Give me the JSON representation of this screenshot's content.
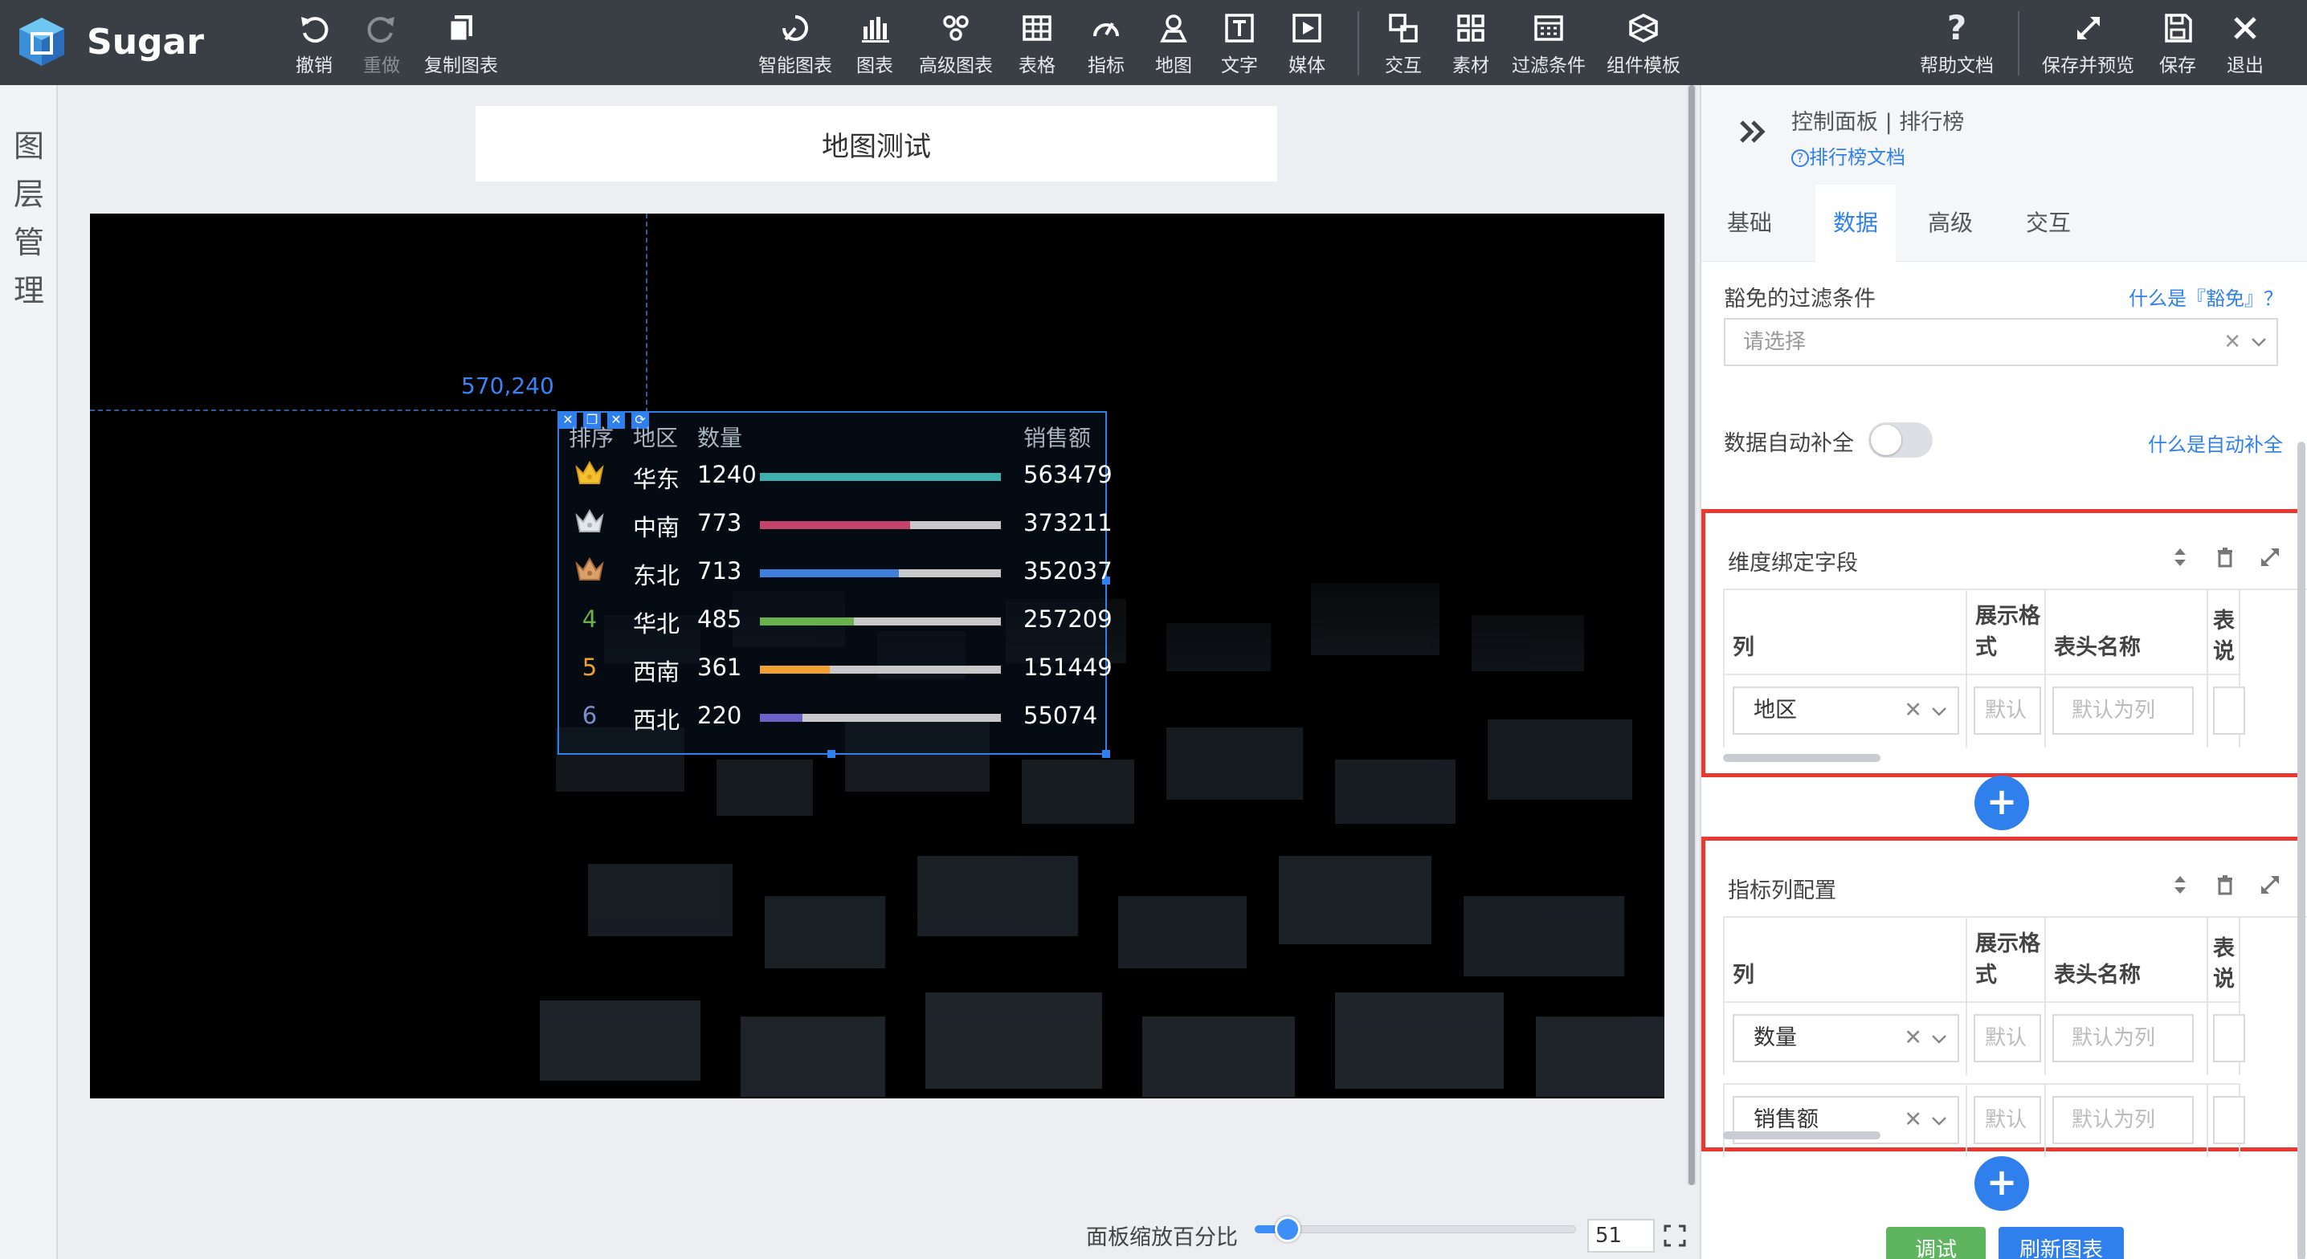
{
  "app": {
    "name": "Sugar"
  },
  "toolbar": {
    "left": [
      {
        "label": "撤销",
        "icon": "undo-icon"
      },
      {
        "label": "重做",
        "icon": "redo-icon",
        "disabled": true
      },
      {
        "label": "复制图表",
        "icon": "copy-icon"
      }
    ],
    "center": [
      {
        "label": "智能图表",
        "icon": "smart-chart-icon"
      },
      {
        "label": "图表",
        "icon": "bar-chart-icon"
      },
      {
        "label": "高级图表",
        "icon": "advanced-chart-icon"
      },
      {
        "label": "表格",
        "icon": "table-icon"
      },
      {
        "label": "指标",
        "icon": "gauge-icon"
      },
      {
        "label": "地图",
        "icon": "map-pin-icon"
      },
      {
        "label": "文字",
        "icon": "text-icon"
      },
      {
        "label": "媒体",
        "icon": "media-icon"
      }
    ],
    "center2": [
      {
        "label": "交互",
        "icon": "interaction-icon"
      },
      {
        "label": "素材",
        "icon": "assets-icon"
      },
      {
        "label": "过滤条件",
        "icon": "filter-icon"
      },
      {
        "label": "组件模板",
        "icon": "component-template-icon"
      }
    ],
    "right": [
      {
        "label": "帮助文档",
        "icon": "help-icon"
      },
      {
        "label": "保存并预览",
        "icon": "expand-icon"
      },
      {
        "label": "保存",
        "icon": "save-icon"
      },
      {
        "label": "退出",
        "icon": "close-icon"
      }
    ]
  },
  "layer_rail": {
    "chars": [
      "图",
      "层",
      "管",
      "理"
    ]
  },
  "canvas": {
    "title": "地图测试",
    "coordinate": "570,240",
    "zoom_label": "面板缩放百分比",
    "zoom_value": "51",
    "zoom_percent": 51
  },
  "rank": {
    "headers": {
      "rank": "排序",
      "region": "地区",
      "qty": "数量",
      "sales": "销售额"
    },
    "rows": [
      {
        "rank": "1",
        "region": "华东",
        "qty": "1240",
        "sales": "563479",
        "ratio": 1.0,
        "color": "#3fb0ac",
        "medal": "gold"
      },
      {
        "rank": "2",
        "region": "中南",
        "qty": "773",
        "sales": "373211",
        "ratio": 0.623,
        "color": "#c3436a",
        "medal": "silver"
      },
      {
        "rank": "3",
        "region": "东北",
        "qty": "713",
        "sales": "352037",
        "ratio": 0.575,
        "color": "#3d7fdb",
        "medal": "bronze"
      },
      {
        "rank": "4",
        "region": "华北",
        "qty": "485",
        "sales": "257209",
        "ratio": 0.391,
        "color": "#6ab04c",
        "num_color": "#6ab04c"
      },
      {
        "rank": "5",
        "region": "西南",
        "qty": "361",
        "sales": "151449",
        "ratio": 0.291,
        "color": "#f0a030",
        "num_color": "#f0a030"
      },
      {
        "rank": "6",
        "region": "西北",
        "qty": "220",
        "sales": "55074",
        "ratio": 0.177,
        "color": "#6a62c9",
        "num_color": "#7b8fcf"
      }
    ]
  },
  "panel": {
    "title": "控制面板 | 排行榜",
    "doc_link": "排行榜文档",
    "tabs": [
      "基础",
      "数据",
      "高级",
      "交互"
    ],
    "active_tab": 1,
    "filter_label": "豁免的过滤条件",
    "filter_help": "什么是『豁免』？",
    "filter_placeholder": "请选择",
    "autofill_label": "数据自动补全",
    "autofill_help": "什么是自动补全",
    "autofill_on": false,
    "dimension": {
      "title": "维度绑定字段",
      "headers": [
        "列",
        "展示格式",
        "表头名称",
        "表说"
      ],
      "rows": [
        {
          "column": "地区",
          "format": "默认",
          "header": "默认为列"
        }
      ]
    },
    "metric": {
      "title": "指标列配置",
      "headers": [
        "列",
        "展示格式",
        "表头名称",
        "表说"
      ],
      "rows": [
        {
          "column": "数量",
          "format": "默认",
          "header": "默认为列"
        },
        {
          "column": "销售额",
          "format": "默认",
          "header": "默认为列"
        }
      ]
    },
    "buttons": {
      "debug": "调试",
      "refresh": "刷新图表"
    }
  },
  "colors": {
    "accent": "#2f80ed",
    "highlight": "#e8382f",
    "toolbar": "#3a3f45",
    "debug_button": "#5fb55f"
  }
}
